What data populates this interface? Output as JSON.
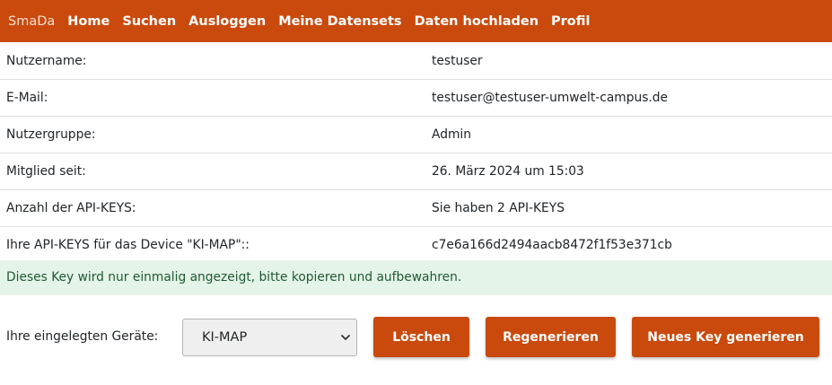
{
  "colors": {
    "accent": "#c94a0c",
    "alert_bg": "#e5f4e8",
    "alert_text": "#1f5a32"
  },
  "nav": {
    "brand": "SmaDa",
    "links": [
      "Home",
      "Suchen",
      "Ausloggen",
      "Meine Datensets",
      "Daten hochladen",
      "Profil"
    ]
  },
  "profile": {
    "rows": [
      {
        "label": "Nutzername:",
        "value": "testuser"
      },
      {
        "label": "E-Mail:",
        "value": "testuser@testuser-umwelt-campus.de"
      },
      {
        "label": "Nutzergruppe:",
        "value": "Admin"
      },
      {
        "label": "Mitglied seit:",
        "value": "26. März 2024 um 15:03"
      },
      {
        "label": "Anzahl der API-KEYS:",
        "value": "Sie haben 2 API-KEYS"
      },
      {
        "label": "Ihre API-KEYS für das Device \"KI-MAP\"::",
        "value": "c7e6a166d2494aacb8472f1f53e371cb"
      }
    ]
  },
  "alert": {
    "text": "Dieses Key wird nur einmalig angezeigt, bitte kopieren und aufbewahren."
  },
  "devices": {
    "label": "Ihre eingelegten Geräte:",
    "selected": "KI-MAP",
    "chevron_icon": "chevron-down-icon"
  },
  "buttons": {
    "delete": "Löschen",
    "regenerate": "Regenerieren",
    "new_key": "Neues Key generieren"
  }
}
